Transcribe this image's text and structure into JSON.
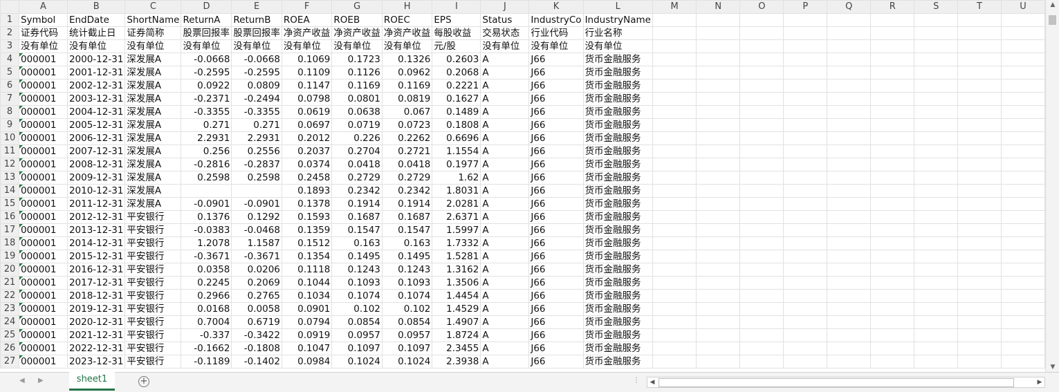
{
  "columns": [
    "A",
    "B",
    "C",
    "D",
    "E",
    "F",
    "G",
    "H",
    "I",
    "J",
    "K",
    "L",
    "M",
    "N",
    "O",
    "P",
    "Q",
    "R",
    "S",
    "T",
    "U"
  ],
  "rows": [
    [
      "Symbol",
      "EndDate",
      "ShortName",
      "ReturnA",
      "ReturnB",
      "ROEA",
      "ROEB",
      "ROEC",
      "EPS",
      "Status",
      "IndustryCo",
      "IndustryName"
    ],
    [
      "证券代码",
      "统计截止日",
      "证券简称",
      "股票回报率",
      "股票回报率",
      "净资产收益",
      "净资产收益",
      "净资产收益",
      "每股收益",
      "交易状态",
      "行业代码",
      "行业名称"
    ],
    [
      "没有单位",
      "没有单位",
      "没有单位",
      "没有单位",
      "没有单位",
      "没有单位",
      "没有单位",
      "没有单位",
      "元/股",
      "没有单位",
      "没有单位",
      "没有单位"
    ],
    [
      "000001",
      "2000-12-31",
      "深发展A",
      "-0.0668",
      "-0.0668",
      "0.1069",
      "0.1723",
      "0.1326",
      "0.2603",
      "A",
      "J66",
      "货币金融服务"
    ],
    [
      "000001",
      "2001-12-31",
      "深发展A",
      "-0.2595",
      "-0.2595",
      "0.1109",
      "0.1126",
      "0.0962",
      "0.2068",
      "A",
      "J66",
      "货币金融服务"
    ],
    [
      "000001",
      "2002-12-31",
      "深发展A",
      "0.0922",
      "0.0809",
      "0.1147",
      "0.1169",
      "0.1169",
      "0.2221",
      "A",
      "J66",
      "货币金融服务"
    ],
    [
      "000001",
      "2003-12-31",
      "深发展A",
      "-0.2371",
      "-0.2494",
      "0.0798",
      "0.0801",
      "0.0819",
      "0.1627",
      "A",
      "J66",
      "货币金融服务"
    ],
    [
      "000001",
      "2004-12-31",
      "深发展A",
      "-0.3355",
      "-0.3355",
      "0.0619",
      "0.0638",
      "0.067",
      "0.1489",
      "A",
      "J66",
      "货币金融服务"
    ],
    [
      "000001",
      "2005-12-31",
      "深发展A",
      "0.271",
      "0.271",
      "0.0697",
      "0.0719",
      "0.0723",
      "0.1808",
      "A",
      "J66",
      "货币金融服务"
    ],
    [
      "000001",
      "2006-12-31",
      "深发展A",
      "2.2931",
      "2.2931",
      "0.2012",
      "0.226",
      "0.2262",
      "0.6696",
      "A",
      "J66",
      "货币金融服务"
    ],
    [
      "000001",
      "2007-12-31",
      "深发展A",
      "0.256",
      "0.2556",
      "0.2037",
      "0.2704",
      "0.2721",
      "1.1554",
      "A",
      "J66",
      "货币金融服务"
    ],
    [
      "000001",
      "2008-12-31",
      "深发展A",
      "-0.2816",
      "-0.2837",
      "0.0374",
      "0.0418",
      "0.0418",
      "0.1977",
      "A",
      "J66",
      "货币金融服务"
    ],
    [
      "000001",
      "2009-12-31",
      "深发展A",
      "0.2598",
      "0.2598",
      "0.2458",
      "0.2729",
      "0.2729",
      "1.62",
      "A",
      "J66",
      "货币金融服务"
    ],
    [
      "000001",
      "2010-12-31",
      "深发展A",
      "",
      "",
      "0.1893",
      "0.2342",
      "0.2342",
      "1.8031",
      "A",
      "J66",
      "货币金融服务"
    ],
    [
      "000001",
      "2011-12-31",
      "深发展A",
      "-0.0901",
      "-0.0901",
      "0.1378",
      "0.1914",
      "0.1914",
      "2.0281",
      "A",
      "J66",
      "货币金融服务"
    ],
    [
      "000001",
      "2012-12-31",
      "平安银行",
      "0.1376",
      "0.1292",
      "0.1593",
      "0.1687",
      "0.1687",
      "2.6371",
      "A",
      "J66",
      "货币金融服务"
    ],
    [
      "000001",
      "2013-12-31",
      "平安银行",
      "-0.0383",
      "-0.0468",
      "0.1359",
      "0.1547",
      "0.1547",
      "1.5997",
      "A",
      "J66",
      "货币金融服务"
    ],
    [
      "000001",
      "2014-12-31",
      "平安银行",
      "1.2078",
      "1.1587",
      "0.1512",
      "0.163",
      "0.163",
      "1.7332",
      "A",
      "J66",
      "货币金融服务"
    ],
    [
      "000001",
      "2015-12-31",
      "平安银行",
      "-0.3671",
      "-0.3671",
      "0.1354",
      "0.1495",
      "0.1495",
      "1.5281",
      "A",
      "J66",
      "货币金融服务"
    ],
    [
      "000001",
      "2016-12-31",
      "平安银行",
      "0.0358",
      "0.0206",
      "0.1118",
      "0.1243",
      "0.1243",
      "1.3162",
      "A",
      "J66",
      "货币金融服务"
    ],
    [
      "000001",
      "2017-12-31",
      "平安银行",
      "0.2245",
      "0.2069",
      "0.1044",
      "0.1093",
      "0.1093",
      "1.3506",
      "A",
      "J66",
      "货币金融服务"
    ],
    [
      "000001",
      "2018-12-31",
      "平安银行",
      "0.2966",
      "0.2765",
      "0.1034",
      "0.1074",
      "0.1074",
      "1.4454",
      "A",
      "J66",
      "货币金融服务"
    ],
    [
      "000001",
      "2019-12-31",
      "平安银行",
      "0.0168",
      "0.0058",
      "0.0901",
      "0.102",
      "0.102",
      "1.4529",
      "A",
      "J66",
      "货币金融服务"
    ],
    [
      "000001",
      "2020-12-31",
      "平安银行",
      "0.7004",
      "0.6719",
      "0.0794",
      "0.0854",
      "0.0854",
      "1.4907",
      "A",
      "J66",
      "货币金融服务"
    ],
    [
      "000001",
      "2021-12-31",
      "平安银行",
      "-0.337",
      "-0.3422",
      "0.0919",
      "0.0957",
      "0.0957",
      "1.8724",
      "A",
      "J66",
      "货币金融服务"
    ],
    [
      "000001",
      "2022-12-31",
      "平安银行",
      "-0.1662",
      "-0.1808",
      "0.1047",
      "0.1097",
      "0.1097",
      "2.3455",
      "A",
      "J66",
      "货币金融服务"
    ],
    [
      "000001",
      "2023-12-31",
      "平安银行",
      "-0.1189",
      "-0.1402",
      "0.0984",
      "0.1024",
      "0.1024",
      "2.3938",
      "A",
      "J66",
      "货币金融服务"
    ]
  ],
  "sheet_tab": "sheet1",
  "add_sheet_symbol": "+",
  "colors": {
    "accent": "#217346",
    "symbol_marker": "#1e7a3a"
  }
}
